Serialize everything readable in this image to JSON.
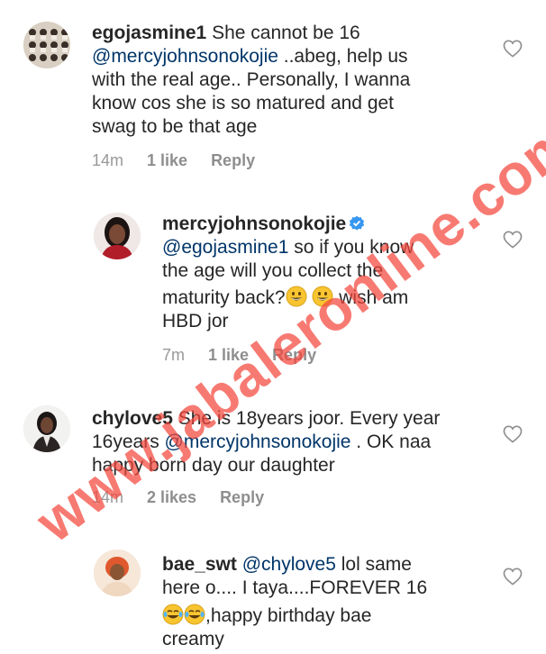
{
  "watermark": "www.jabaleronline.com",
  "comments": [
    {
      "username": "egojasmine1",
      "text_1": " She cannot be 16",
      "mention": "@mercyjohnsonokojie",
      "text_2": " ..abeg, help us",
      "text_3": "with the real age.. Personally,  I wanna",
      "text_4": "know cos she is so matured and get",
      "text_5": "swag to be that age",
      "time": "14m",
      "likes": "1 like",
      "reply": "Reply"
    },
    {
      "username": "mercyjohnsonokojie",
      "mention": "@egojasmine1",
      "text_1": "  so if you know",
      "text_2": "the age will you collect the",
      "text_3": "maturity back?",
      "text_4": "  wish am",
      "text_5": "HBD jor",
      "time": "7m",
      "likes": "1 like",
      "reply": "Reply",
      "verified_icon": "verified-badge-icon",
      "accent": "#3897f0"
    },
    {
      "username": "chylove5",
      "text_1": " She is 18years joor. Every year",
      "text_2": "16years ",
      "mention": "@mercyjohnsonokojie",
      "text_3": " . OK naa",
      "text_4": "happy born day our daughter",
      "time": "14m",
      "likes": "2 likes",
      "reply": "Reply"
    },
    {
      "username": "bae_swt",
      "mention": "@chylove5",
      "text_1": "  lol same",
      "text_2": "here o.... I taya....FOREVER 16",
      "text_3": ",happy birthday bae",
      "text_4": "creamy"
    }
  ]
}
